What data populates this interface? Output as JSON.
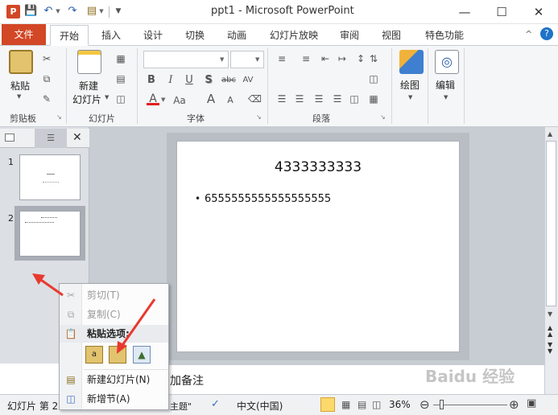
{
  "window": {
    "title": "ppt1 - Microsoft PowerPoint",
    "minimize_icon": "minimize-icon",
    "maximize_icon": "maximize-icon",
    "close_icon": "close-icon"
  },
  "quick_access": {
    "save_icon": "save-icon",
    "undo_icon": "undo-icon",
    "redo_icon": "redo-icon",
    "new_icon": "new-slide-icon"
  },
  "tabs": {
    "file": "文件",
    "home": "开始",
    "insert": "插入",
    "design": "设计",
    "transitions": "切换",
    "animations": "动画",
    "slideshow": "幻灯片放映",
    "review": "审阅",
    "view": "视图",
    "special": "特色功能"
  },
  "ribbon": {
    "clipboard": {
      "group": "剪贴板",
      "paste": "粘贴"
    },
    "slides": {
      "group": "幻灯片",
      "new_slide_line1": "新建",
      "new_slide_line2": "幻灯片"
    },
    "font": {
      "group": "字体",
      "bold": "B",
      "italic": "I",
      "underline": "U",
      "shadow": "S",
      "strike": "abc",
      "case": "Aa",
      "grow": "A",
      "shrink": "A"
    },
    "paragraph": {
      "group": "段落"
    },
    "drawing": {
      "label": "绘图"
    },
    "editing": {
      "label": "编辑"
    }
  },
  "panel": {
    "slide_numbers": [
      "1",
      "2"
    ]
  },
  "slide": {
    "title": "4333333333",
    "bullet": "6555555555555555555"
  },
  "notes": {
    "placeholder": "加备注"
  },
  "context_menu": {
    "cut": "剪切(T)",
    "copy": "复制(C)",
    "paste_options": "粘贴选项:",
    "new_slide": "新建幻灯片(N)",
    "add_section": "新增节(A)"
  },
  "status": {
    "slide_info": "幻灯片 第 2",
    "theme": "主题\"",
    "language": "中文(中国)",
    "zoom": "36%"
  },
  "watermark": {
    "text": "Baidu 经验"
  },
  "colors": {
    "file_tab": "#d24726",
    "accent_arrow": "#e8392f",
    "ribbon_bg": "#f5f6f7"
  }
}
